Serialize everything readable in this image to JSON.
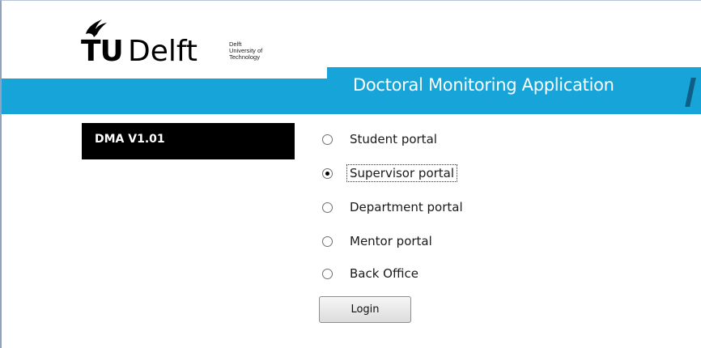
{
  "logo": {
    "mark": "TU",
    "name": "Delft",
    "subtitle": "Delft\nUniversity of\nTechnology"
  },
  "header": {
    "title": "Doctoral Monitoring Application"
  },
  "version": {
    "label": "DMA V1.01"
  },
  "portals": [
    {
      "label": "Student portal",
      "checked": false
    },
    {
      "label": "Supervisor portal",
      "checked": true
    },
    {
      "label": "Department portal",
      "checked": false
    },
    {
      "label": "Mentor portal",
      "checked": false
    },
    {
      "label": "Back Office",
      "checked": false
    }
  ],
  "login": {
    "label": "Login"
  },
  "colors": {
    "band": "#17a4d8",
    "version_bg": "#000000"
  }
}
